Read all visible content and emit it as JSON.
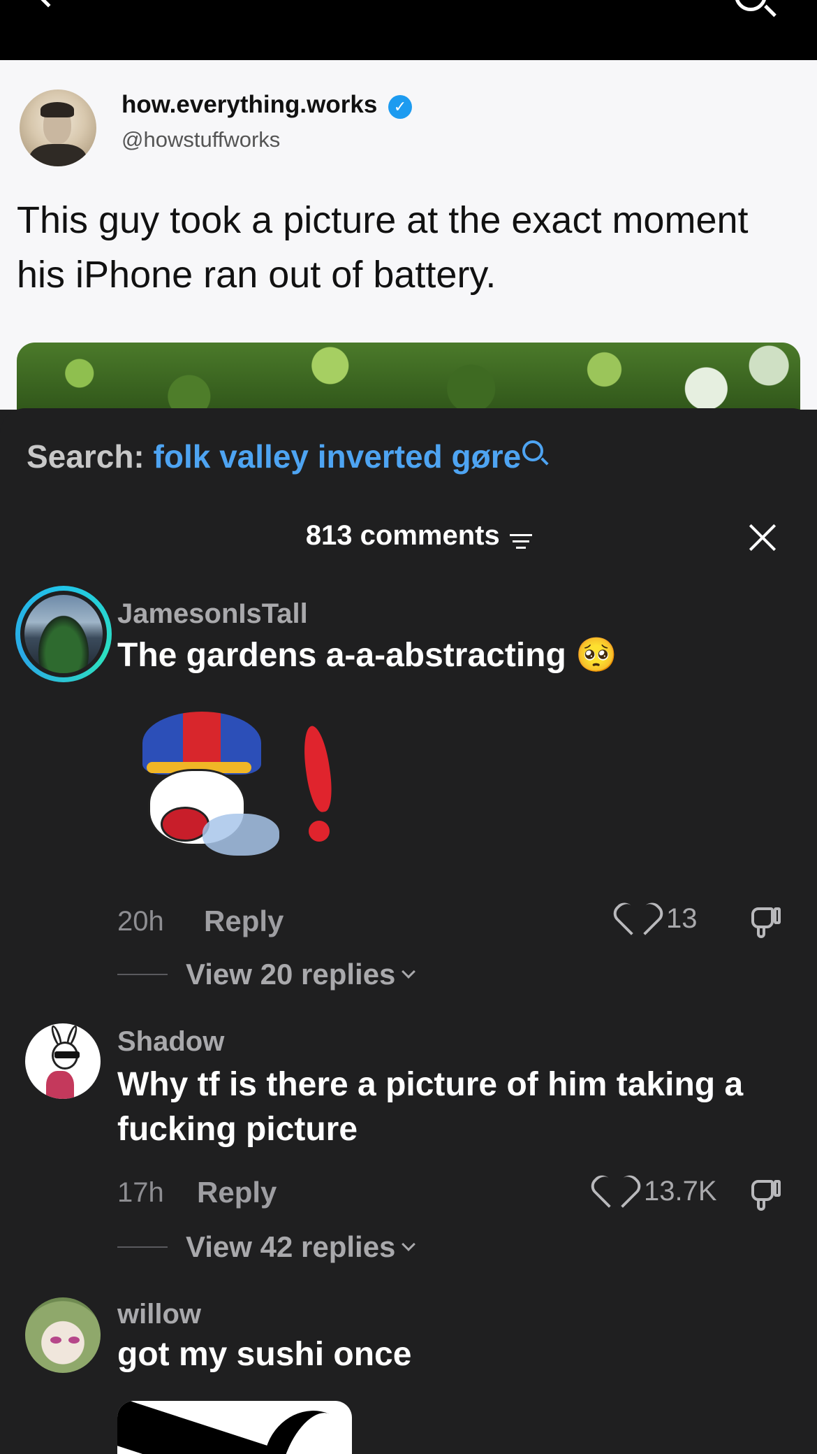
{
  "post": {
    "display_name": "how.everything.works",
    "handle": "@howstuffworks",
    "text": "This guy took a picture at the exact moment his iPhone ran out of battery."
  },
  "sheet": {
    "search_label": "Search:",
    "search_query": "folk valley inverted gøre",
    "comment_count": "813 comments"
  },
  "comments": [
    {
      "user": "JamesonIsTall",
      "text": "The gardens a-a-abstracting 🥺",
      "time": "20h",
      "reply_label": "Reply",
      "likes": "13",
      "view_replies": "View 20 replies"
    },
    {
      "user": "Shadow",
      "text": "Why tf is there a picture of him taking a fucking picture",
      "time": "17h",
      "reply_label": "Reply",
      "likes": "13.7K",
      "view_replies": "View 42 replies"
    },
    {
      "user": "willow",
      "text": "got my sushi once"
    }
  ],
  "colors": {
    "accent": "#4ea4f2",
    "verified": "#1d9bf0",
    "sheet_bg": "#1f1f20",
    "avatar_ring": "#21c4e8"
  },
  "icons": [
    "back-chevron-icon",
    "search-icon",
    "verified-badge-icon",
    "filter-icon",
    "close-icon",
    "heart-icon",
    "dislike-icon",
    "chevron-down-icon"
  ]
}
